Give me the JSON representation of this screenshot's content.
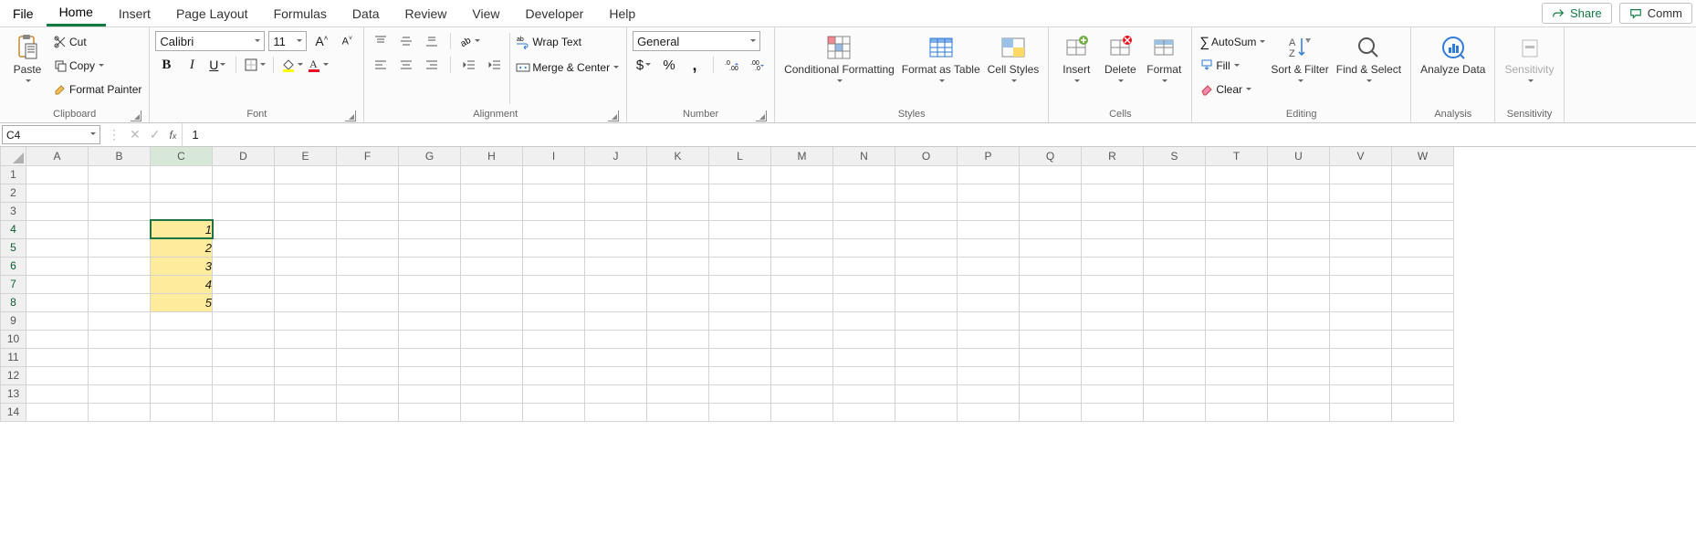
{
  "tabs": {
    "file": "File",
    "home": "Home",
    "insert": "Insert",
    "page_layout": "Page Layout",
    "formulas": "Formulas",
    "data": "Data",
    "review": "Review",
    "view": "View",
    "developer": "Developer",
    "help": "Help",
    "share": "Share",
    "comments": "Comm"
  },
  "clipboard": {
    "paste": "Paste",
    "cut": "Cut",
    "copy": "Copy",
    "format_painter": "Format Painter",
    "group": "Clipboard"
  },
  "font": {
    "name": "Calibri",
    "size": "11",
    "group": "Font"
  },
  "alignment": {
    "wrap": "Wrap Text",
    "merge": "Merge & Center",
    "group": "Alignment"
  },
  "number": {
    "format": "General",
    "group": "Number"
  },
  "styles": {
    "cond": "Conditional Formatting",
    "table": "Format as Table",
    "cell": "Cell Styles",
    "group": "Styles"
  },
  "cells": {
    "insert": "Insert",
    "delete": "Delete",
    "format": "Format",
    "group": "Cells"
  },
  "editing": {
    "autosum": "AutoSum",
    "fill": "Fill",
    "clear": "Clear",
    "sort": "Sort & Filter",
    "find": "Find & Select",
    "group": "Editing"
  },
  "analysis": {
    "analyze": "Analyze Data",
    "group": "Analysis"
  },
  "sensitivity": {
    "label": "Sensitivity",
    "group": "Sensitivity"
  },
  "formula_bar": {
    "name_box": "C4",
    "value": "1"
  },
  "columns": [
    "A",
    "B",
    "C",
    "D",
    "E",
    "F",
    "G",
    "H",
    "I",
    "J",
    "K",
    "L",
    "M",
    "N",
    "O",
    "P",
    "Q",
    "R",
    "S",
    "T",
    "U",
    "V",
    "W"
  ],
  "rows": [
    1,
    2,
    3,
    4,
    5,
    6,
    7,
    8,
    9,
    10,
    11,
    12,
    13,
    14
  ],
  "selected_cell": "C4",
  "data_cells": {
    "C4": "1",
    "C5": "2",
    "C6": "3",
    "C7": "4",
    "C8": "5"
  }
}
